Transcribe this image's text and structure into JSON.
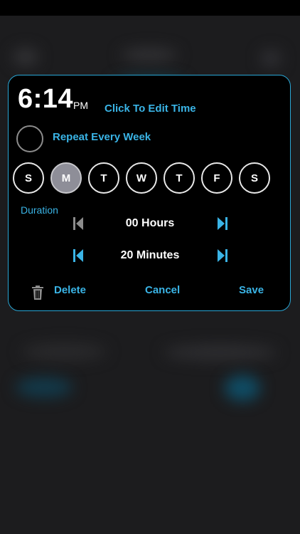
{
  "alarm": {
    "time": "6:14",
    "ampm": "PM",
    "edit_time_label": "Click To Edit Time"
  },
  "repeat": {
    "label": "Repeat Every Week",
    "checked": false
  },
  "days": [
    {
      "label": "S",
      "selected": false
    },
    {
      "label": "M",
      "selected": true
    },
    {
      "label": "T",
      "selected": false
    },
    {
      "label": "W",
      "selected": false
    },
    {
      "label": "T",
      "selected": false
    },
    {
      "label": "F",
      "selected": false
    },
    {
      "label": "S",
      "selected": false
    }
  ],
  "duration": {
    "label": "Duration",
    "hours": "00  Hours",
    "minutes": "20 Minutes"
  },
  "actions": {
    "delete_label": "Delete",
    "cancel_label": "Cancel",
    "save_label": "Save"
  },
  "colors": {
    "accent": "#3ab4e6",
    "disabled": "#8c8c8c",
    "selected_day": "#8e8e98"
  },
  "icons": {
    "hours_decrement": "skip-back-icon",
    "hours_increment": "skip-forward-icon",
    "minutes_decrement": "skip-back-icon",
    "minutes_increment": "skip-forward-icon",
    "delete": "trash-icon"
  }
}
